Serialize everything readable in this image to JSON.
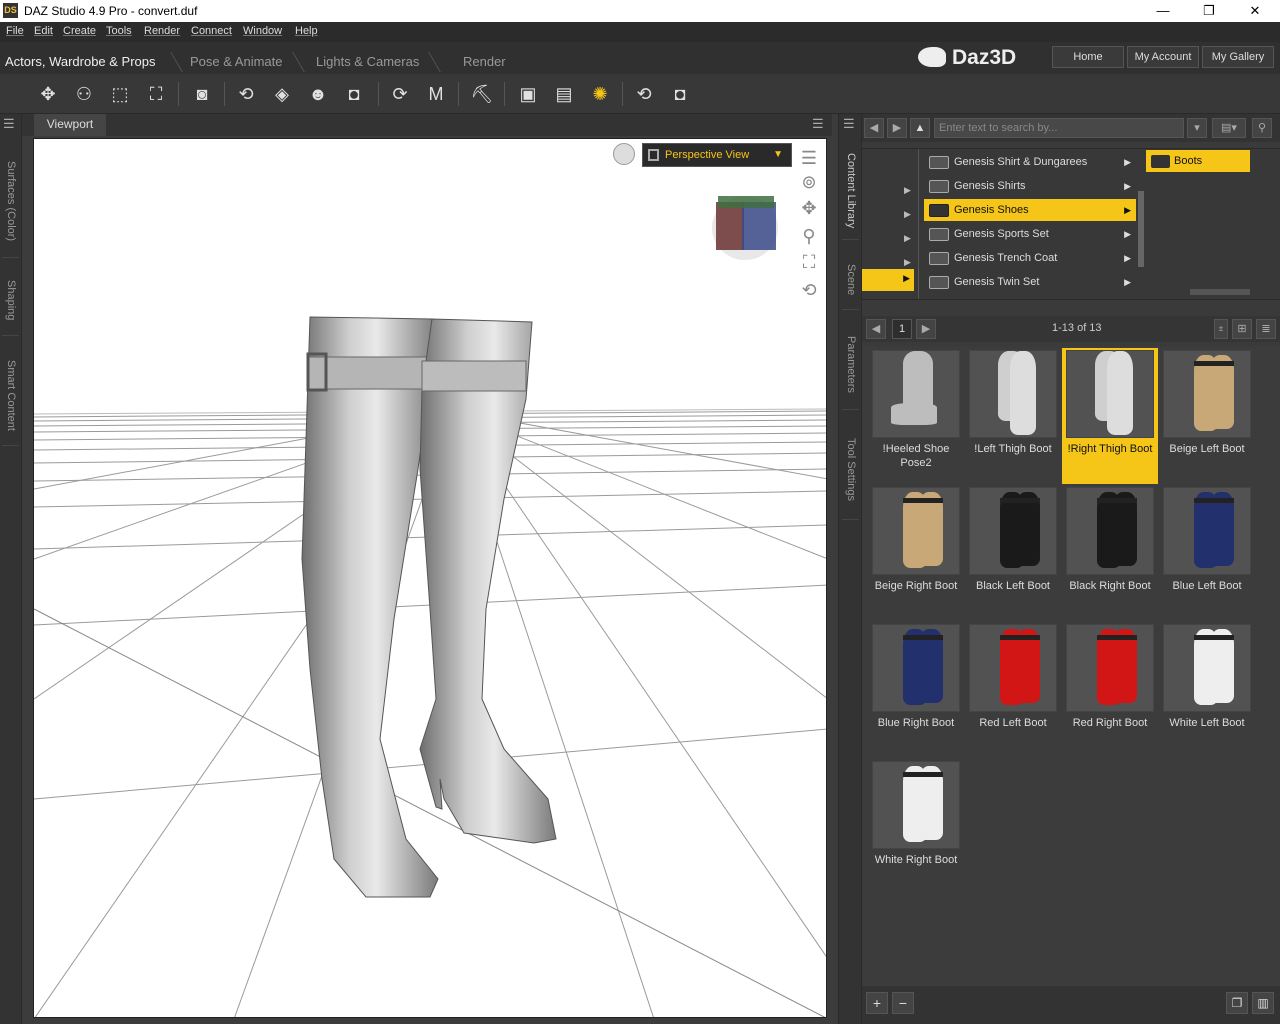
{
  "window": {
    "title": "DAZ Studio 4.9 Pro - convert.duf",
    "app_icon": "DS",
    "minimize": "—",
    "maximize": "❐",
    "close": "✕"
  },
  "menu": [
    "File",
    "Edit",
    "Create",
    "Tools",
    "Render",
    "Connect",
    "Window",
    "Help"
  ],
  "room_tabs": [
    {
      "label": "Actors, Wardrobe & Props",
      "active": true
    },
    {
      "label": "Pose & Animate",
      "active": false
    },
    {
      "label": "Lights & Cameras",
      "active": false
    },
    {
      "label": "Render",
      "active": false
    }
  ],
  "brand": "Daz3D",
  "nav_buttons": [
    "Home",
    "My Account",
    "My Gallery"
  ],
  "left_panes": [
    "Surfaces (Color)",
    "Shaping",
    "Smart Content"
  ],
  "right_panes": [
    "Content Library",
    "Scene",
    "Parameters",
    "Tool Settings"
  ],
  "viewport": {
    "tab": "Viewport",
    "view_selector": "Perspective View",
    "accent": "#f5c518"
  },
  "content_library": {
    "search_placeholder": "Enter text to search by...",
    "folders": [
      {
        "label": "Genesis Shirt & Dungarees",
        "selected": false
      },
      {
        "label": "Genesis Shirts",
        "selected": false
      },
      {
        "label": "Genesis Shoes",
        "selected": true
      },
      {
        "label": "Genesis Sports Set",
        "selected": false
      },
      {
        "label": "Genesis Trench Coat",
        "selected": false
      },
      {
        "label": "Genesis Twin Set",
        "selected": false
      }
    ],
    "subfolder": "Boots",
    "page": "1",
    "count": "1-13 of 13",
    "items": [
      {
        "label": "!Heeled Shoe Pose2",
        "color": "#bdbdbd",
        "selected": false
      },
      {
        "label": "!Left Thigh Boot",
        "color": "#cfcfcf",
        "selected": false
      },
      {
        "label": "!Right Thigh Boot",
        "color": "#cfcfcf",
        "selected": true
      },
      {
        "label": "Beige Left Boot",
        "color": "#c9a878",
        "selected": false
      },
      {
        "label": "Beige Right Boot",
        "color": "#c9a878",
        "selected": false
      },
      {
        "label": "Black Left Boot",
        "color": "#1a1a1a",
        "selected": false
      },
      {
        "label": "Black Right Boot",
        "color": "#1a1a1a",
        "selected": false
      },
      {
        "label": "Blue Left Boot",
        "color": "#22306e",
        "selected": false
      },
      {
        "label": "Blue Right Boot",
        "color": "#22306e",
        "selected": false
      },
      {
        "label": "Red Left Boot",
        "color": "#d21515",
        "selected": false
      },
      {
        "label": "Red Right Boot",
        "color": "#d21515",
        "selected": false
      },
      {
        "label": "White Left Boot",
        "color": "#eeeeee",
        "selected": false
      },
      {
        "label": "White Right Boot",
        "color": "#eeeeee",
        "selected": false
      }
    ]
  },
  "bottom": {
    "add": "+",
    "remove": "−"
  }
}
